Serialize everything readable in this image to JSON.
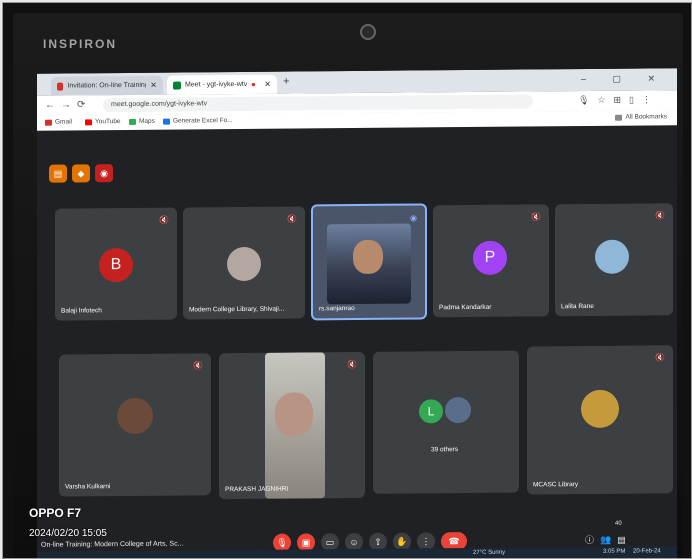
{
  "laptop": {
    "brand": "INSPIRON"
  },
  "browser": {
    "tabs": [
      {
        "label": "Invitation: On-line Training: Mod"
      },
      {
        "label": "Meet - ygt-ivyke-wtv"
      }
    ],
    "new_tab": "+",
    "window_controls": "– ▢ ✕",
    "url": "meet.google.com/ygt-ivyke-wtv",
    "bookmarks": [
      {
        "label": "Gmail",
        "color": "#d93025"
      },
      {
        "label": "YouTube",
        "color": "#ff0000"
      },
      {
        "label": "Maps",
        "color": "#34a853"
      },
      {
        "label": "Generate Excel Fo...",
        "color": "#1a73e8"
      }
    ],
    "bookmarks_right": "All Bookmarks"
  },
  "meet": {
    "participants": [
      {
        "name": "Balaji Infotech",
        "initial": "B",
        "avatar_color": "#c5221f"
      },
      {
        "name": "Modern College Library, Shivaji...",
        "initial": "",
        "avatar_color": "#b3a7a0"
      },
      {
        "name": "rs.sanjanrao",
        "initial": "",
        "avatar_color": "#3a4a6a"
      },
      {
        "name": "Padma Kandarkar",
        "initial": "P",
        "avatar_color": "#a142f4"
      },
      {
        "name": "Lalita Rane",
        "initial": "",
        "avatar_color": "#8fb7d8"
      },
      {
        "name": "Varsha Kulkarni",
        "initial": "",
        "avatar_color": "#6b4a3a"
      },
      {
        "name": "PRAKASH JAGNIHRI",
        "initial": "",
        "avatar_color": "#8a7a6a"
      },
      {
        "name": "39 others",
        "initial": "L",
        "avatar_color": "#34a853"
      },
      {
        "name": "MCASC Library",
        "initial": "",
        "avatar_color": "#c49a3a"
      }
    ],
    "meeting_title": "On-line Training: Modern College of Arts, Sc...",
    "participant_count": "40"
  },
  "taskbar": {
    "weather": "27°C Sunny",
    "time": "3:05 PM",
    "date": "20-Feb-24"
  },
  "camera_watermark": {
    "model": "OPPO F7",
    "timestamp": "2024/02/20 15:05"
  }
}
